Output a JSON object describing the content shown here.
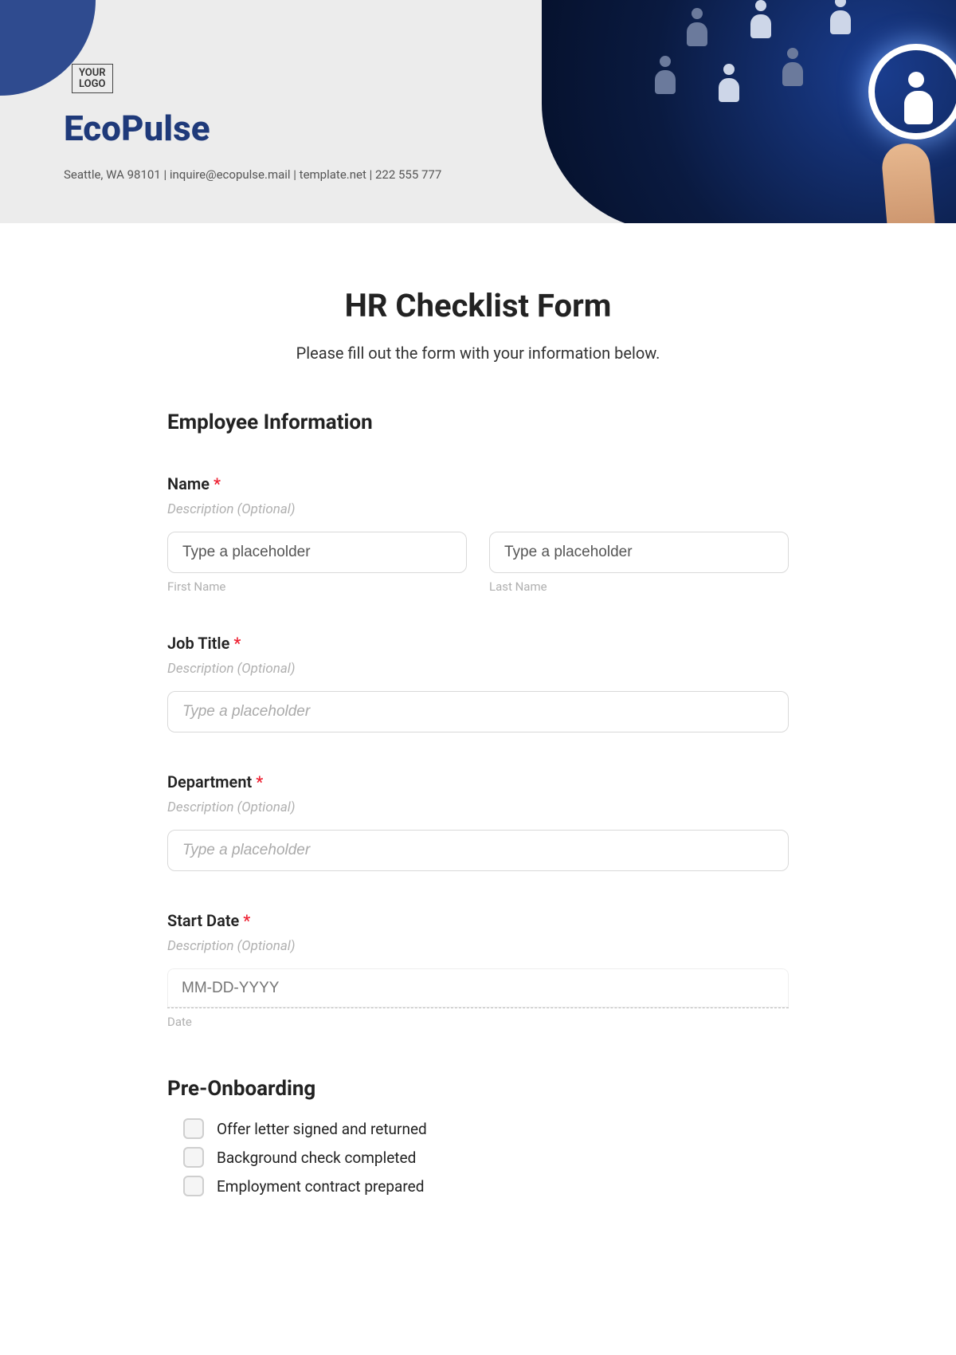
{
  "header": {
    "logo_placeholder_line1": "YOUR",
    "logo_placeholder_line2": "LOGO",
    "brand": "EcoPulse",
    "contact_line": "Seattle, WA 98101 | inquire@ecopulse.mail | template.net | 222 555 777"
  },
  "form": {
    "title": "HR Checklist Form",
    "subtitle": "Please fill out the form with your information below."
  },
  "section_employee": {
    "heading": "Employee Information",
    "name": {
      "label": "Name",
      "required": "*",
      "desc": "Description (Optional)",
      "first_placeholder": "Type a placeholder",
      "first_sublabel": "First Name",
      "last_placeholder": "Type a placeholder",
      "last_sublabel": "Last Name"
    },
    "job_title": {
      "label": "Job Title",
      "required": "*",
      "desc": "Description (Optional)",
      "placeholder": "Type a placeholder"
    },
    "department": {
      "label": "Department",
      "required": "*",
      "desc": "Description (Optional)",
      "placeholder": "Type a placeholder"
    },
    "start_date": {
      "label": "Start Date",
      "required": "*",
      "desc": "Description (Optional)",
      "placeholder": "MM-DD-YYYY",
      "sublabel": "Date"
    }
  },
  "section_preonboarding": {
    "heading": "Pre-Onboarding",
    "items": [
      "Offer letter signed and returned",
      "Background check completed",
      "Employment contract prepared"
    ]
  }
}
